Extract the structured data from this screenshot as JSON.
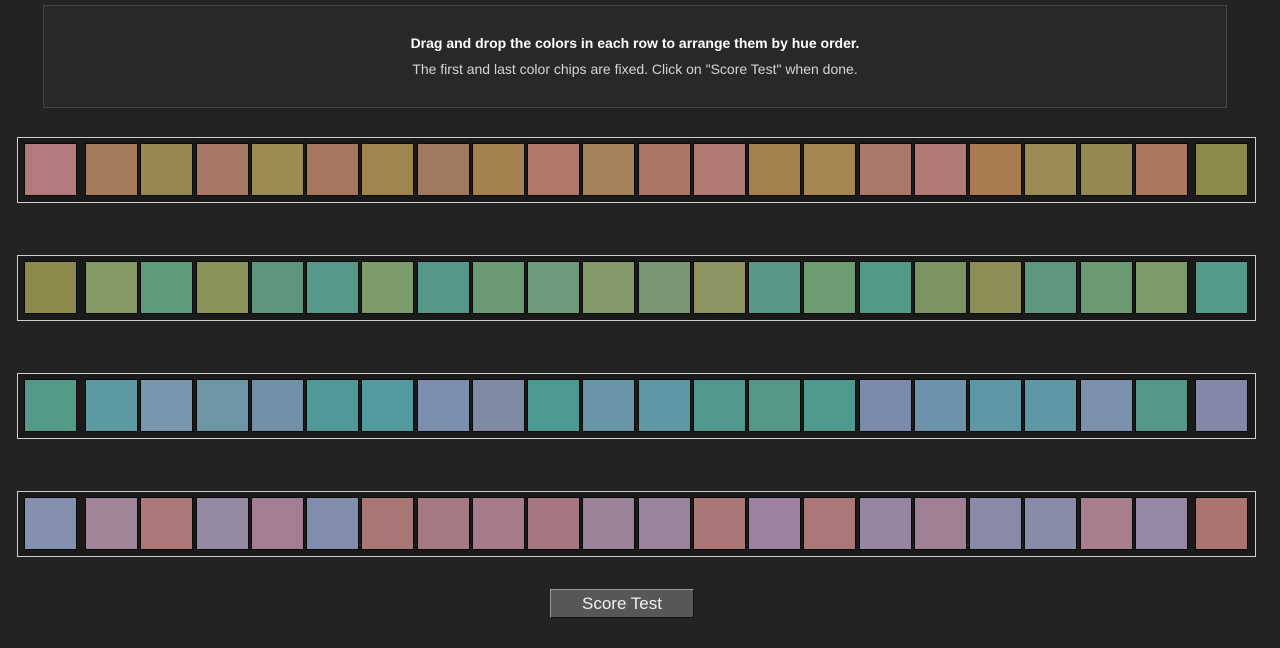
{
  "instructions": {
    "line1": "Drag and drop the colors in each row to arrange them by hue order.",
    "line2": "The first and last color chips are fixed. Click on \"Score Test\" when done."
  },
  "score_button": {
    "label": "Score Test"
  },
  "rows": [
    [
      "#b27a7a",
      "#a57a58",
      "#988650",
      "#a77866",
      "#9c8b52",
      "#a7765e",
      "#a0864e",
      "#a07a5e",
      "#a68150",
      "#b07868",
      "#a6825a",
      "#ab7564",
      "#b07a74",
      "#a4804c",
      "#a48650",
      "#a9786a",
      "#b27a76",
      "#a87c50",
      "#9b8b54",
      "#958952",
      "#a8775e",
      "#8e8a4c"
    ],
    [
      "#8e8a4c",
      "#859a62",
      "#5f9a7a",
      "#8b9258",
      "#5d967c",
      "#56998a",
      "#7c9a6a",
      "#57968a",
      "#6c9a74",
      "#6d9a78",
      "#849a6a",
      "#7a9574",
      "#8c9260",
      "#599686",
      "#6e9c72",
      "#529886",
      "#7c9462",
      "#8d8e58",
      "#5e967e",
      "#6c9a72",
      "#7e9a6a",
      "#549b8e"
    ],
    [
      "#549a88",
      "#5c99a2",
      "#7896ac",
      "#6c96a6",
      "#7090a8",
      "#4f9a98",
      "#539aa0",
      "#7c8ead",
      "#7f8aa4",
      "#4a9a92",
      "#6896a6",
      "#5e98a4",
      "#50988e",
      "#569686",
      "#4e9a8e",
      "#7c8aac",
      "#6c92ac",
      "#5e98a6",
      "#5e98a6",
      "#7a90ac",
      "#55968a",
      "#8488a6"
    ],
    [
      "#8390ae",
      "#a08498",
      "#ac7878",
      "#948aa2",
      "#a47c94",
      "#828cac",
      "#a87674",
      "#a67a84",
      "#a67a8a",
      "#a87680",
      "#9a8298",
      "#9a849c",
      "#aa7676",
      "#9c829e",
      "#aa7878",
      "#9686a0",
      "#a07e94",
      "#8a8aa6",
      "#888ca8",
      "#a87e8e",
      "#9688a4",
      "#aa7472"
    ]
  ]
}
